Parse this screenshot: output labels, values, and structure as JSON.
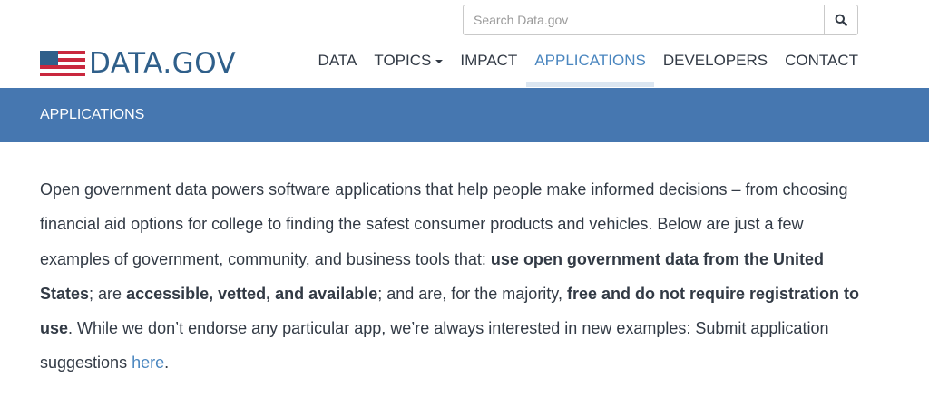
{
  "search": {
    "placeholder": "Search Data.gov",
    "icon": "search-icon"
  },
  "logo": {
    "text": "DATA.GOV",
    "flag_colors": [
      "#c9283e",
      "#ffffff",
      "#2f5f8a"
    ]
  },
  "nav": {
    "items": [
      {
        "label": "DATA"
      },
      {
        "label": "TOPICS",
        "dropdown": true
      },
      {
        "label": "IMPACT"
      },
      {
        "label": "APPLICATIONS",
        "active": true
      },
      {
        "label": "DEVELOPERS"
      },
      {
        "label": "CONTACT"
      }
    ]
  },
  "banner": {
    "title": "APPLICATIONS",
    "color": "#4677b0"
  },
  "intro": {
    "p1": "Open government data powers software applications that help people make informed decisions – from choosing financial aid options for college to finding the safest consumer products and vehicles. Below are just a few examples of government, community, and business tools that: ",
    "b1": "use open government data from the United States",
    "p2": "; are ",
    "b2": "accessible, vetted, and available",
    "p3": "; and are, for the majority, ",
    "b3": "free and do not require registration to use",
    "p4": ". While we don’t endorse any particular app, we’re always interested in new examples: Submit application suggestions ",
    "link": "here",
    "p5": "."
  },
  "colors": {
    "accent": "#4a86bf",
    "text": "#323a45"
  }
}
